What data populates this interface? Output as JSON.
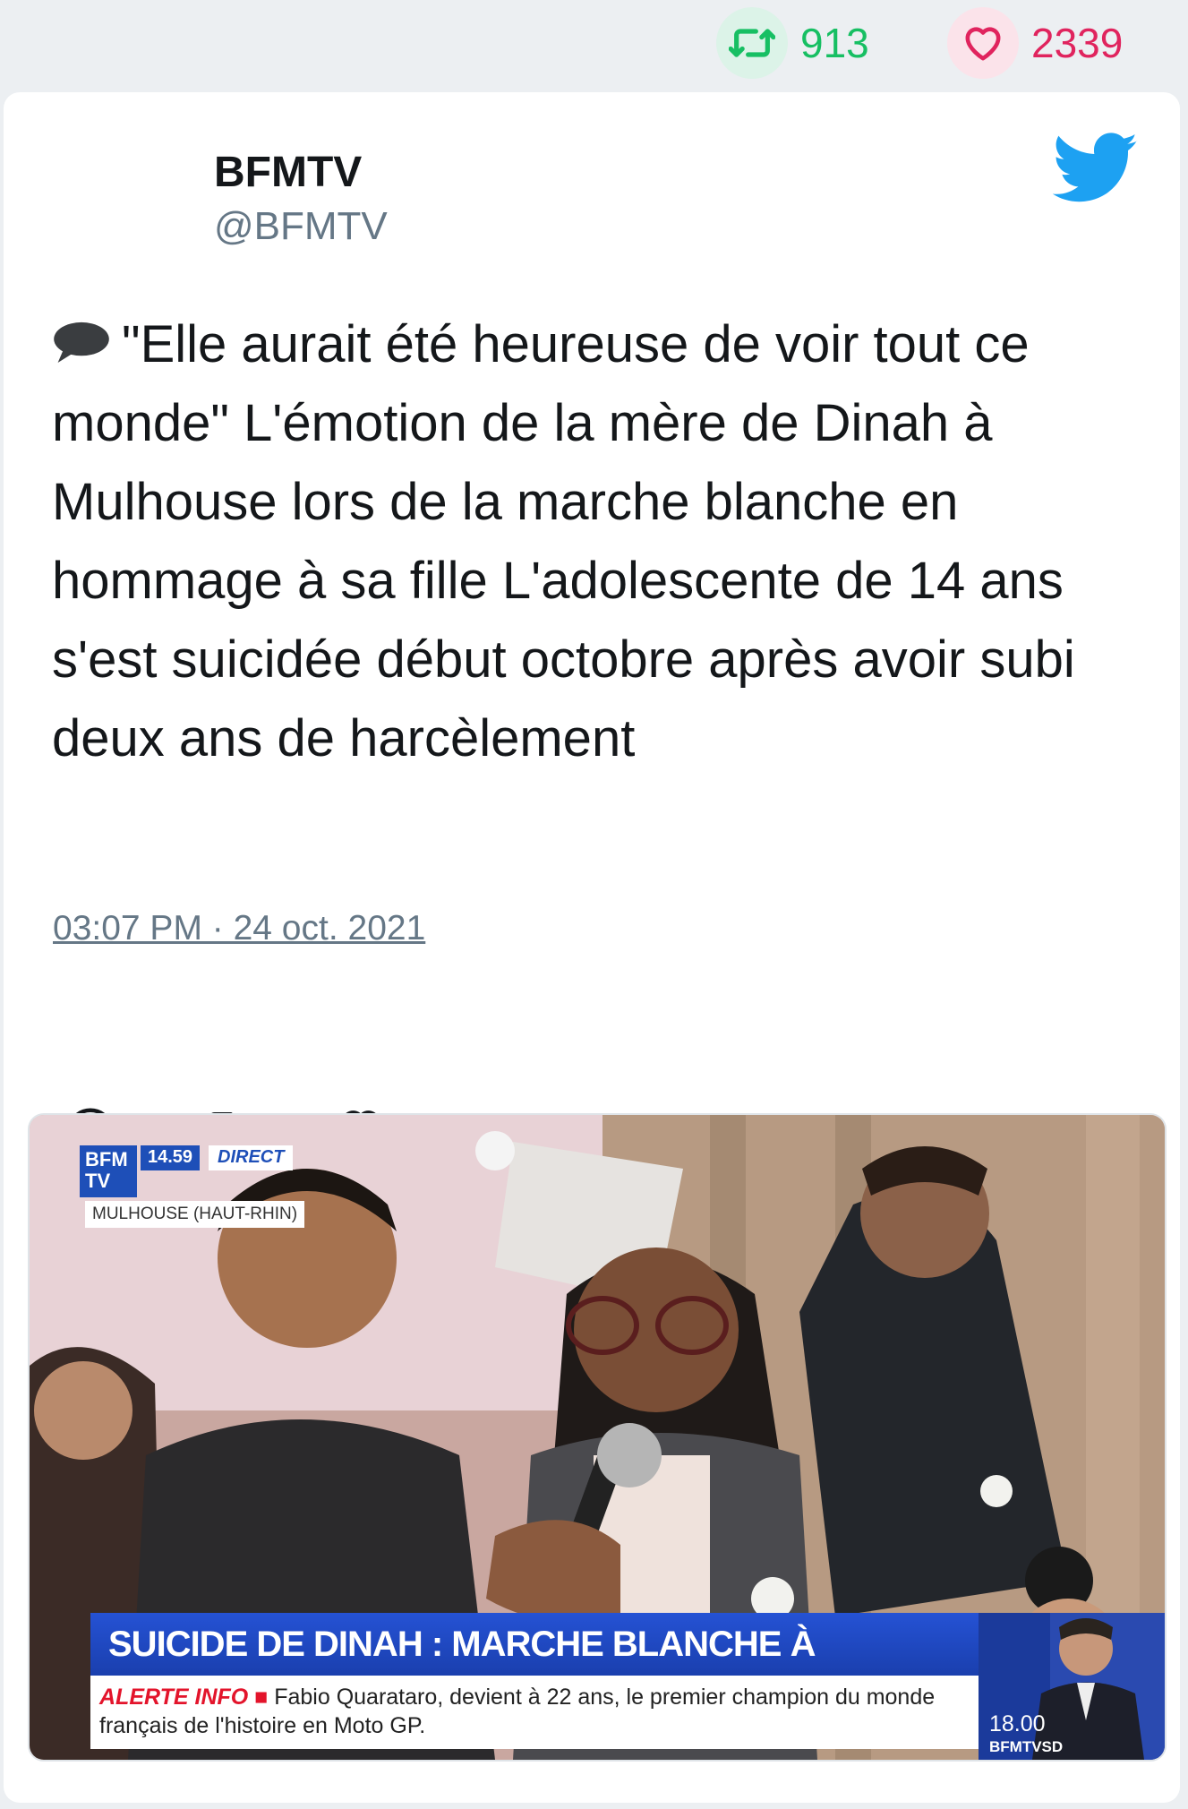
{
  "stats": {
    "retweets": "913",
    "likes": "2339"
  },
  "author": {
    "name": "BFMTV",
    "handle": "@BFMTV"
  },
  "tweet": {
    "text": "\"Elle aurait été heureuse de voir tout ce monde\" L'émotion de la mère de Dinah à Mulhouse lors de la marche blanche en hommage à sa fille L'adolescente de 14 ans s'est suicidée début octobre après avoir subi deux ans de harcèlement",
    "timestamp": "03:07 PM · 24 oct. 2021"
  },
  "media": {
    "channel_logo": "BFM TV",
    "live_time": "14.59",
    "live_label": "DIRECT",
    "location": "MULHOUSE (HAUT-RHIN)",
    "headline": "SUICIDE DE DINAH : MARCHE BLANCHE À MULHOUSE",
    "alert_label": "ALERTE INFO",
    "alert_text": "Fabio Quarataro, devient à 22 ans, le premier champion du monde français de l'histoire en Moto GP.",
    "anchor_time": "18.00",
    "anchor_show": "BFMTVSD"
  },
  "icons": {
    "retweet": "retweet-icon",
    "like": "heart-icon",
    "reply": "reply-icon",
    "twitter": "twitter-bird-icon",
    "speech": "speech-bubble-icon"
  },
  "colors": {
    "retweet": "#17bf63",
    "like": "#e0245e",
    "twitter_blue": "#1da1f2",
    "secondary_text": "#657786",
    "bfm_blue": "#1e4fb8"
  }
}
